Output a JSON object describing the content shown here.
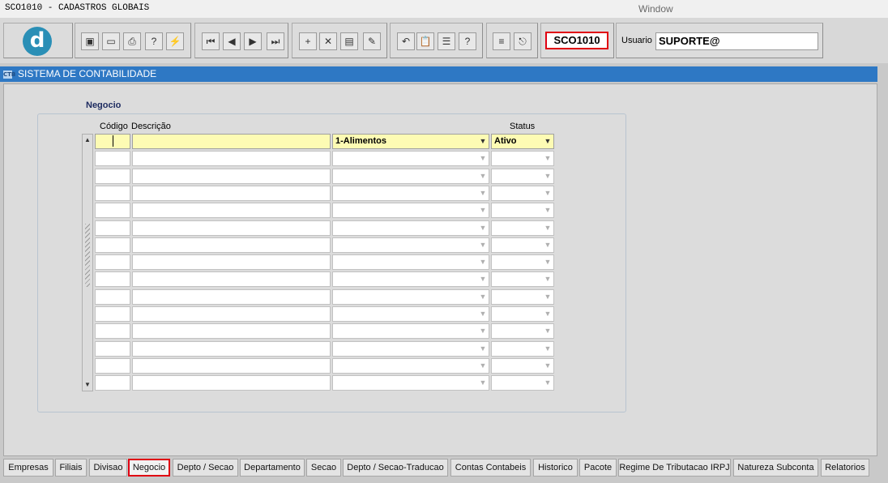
{
  "window": {
    "title": "SCO1010 - CADASTROS GLOBAIS",
    "menu": "Window"
  },
  "toolbar": {
    "logo_letter": "d",
    "form_code": "SCO1010",
    "user_label": "Usuario",
    "user_value": "SUPORTE@",
    "buttons": [
      {
        "name": "save-icon",
        "glyph": "▣"
      },
      {
        "name": "print-screen-icon",
        "glyph": "▭"
      },
      {
        "name": "printer-icon",
        "glyph": "⎙"
      },
      {
        "name": "enter-query-icon",
        "glyph": "?"
      },
      {
        "name": "execute-query-icon",
        "glyph": "⚡"
      },
      {
        "name": "first-record-icon",
        "glyph": "⏮"
      },
      {
        "name": "previous-record-icon",
        "glyph": "◀"
      },
      {
        "name": "next-record-icon",
        "glyph": "▶"
      },
      {
        "name": "last-record-icon",
        "glyph": "⏭"
      },
      {
        "name": "insert-record-icon",
        "glyph": "+"
      },
      {
        "name": "delete-record-icon",
        "glyph": "✕"
      },
      {
        "name": "duplicate-record-icon",
        "glyph": "▤"
      },
      {
        "name": "edit-record-icon",
        "glyph": "✎"
      },
      {
        "name": "undo-icon",
        "glyph": "↶"
      },
      {
        "name": "clipboard-icon",
        "glyph": "📋"
      },
      {
        "name": "list-values-icon",
        "glyph": "☰"
      },
      {
        "name": "help-icon",
        "glyph": "?"
      },
      {
        "name": "menu-icon",
        "glyph": "≡"
      },
      {
        "name": "exit-icon",
        "glyph": "⎋"
      }
    ]
  },
  "system_bar": {
    "icon": "ctb-icon",
    "icon_text": "CTB",
    "title": "SISTEMA DE CONTABILIDADE"
  },
  "block": {
    "title": "Negocio",
    "headers": {
      "codigo": "Código",
      "descricao": "Descrição",
      "status": "Status"
    },
    "rows": [
      {
        "codigo": "",
        "descricao": "",
        "grupo": "1-Alimentos",
        "status": "Ativo"
      },
      {
        "codigo": "",
        "descricao": "",
        "grupo": "",
        "status": ""
      },
      {
        "codigo": "",
        "descricao": "",
        "grupo": "",
        "status": ""
      },
      {
        "codigo": "",
        "descricao": "",
        "grupo": "",
        "status": ""
      },
      {
        "codigo": "",
        "descricao": "",
        "grupo": "",
        "status": ""
      },
      {
        "codigo": "",
        "descricao": "",
        "grupo": "",
        "status": ""
      },
      {
        "codigo": "",
        "descricao": "",
        "grupo": "",
        "status": ""
      },
      {
        "codigo": "",
        "descricao": "",
        "grupo": "",
        "status": ""
      },
      {
        "codigo": "",
        "descricao": "",
        "grupo": "",
        "status": ""
      },
      {
        "codigo": "",
        "descricao": "",
        "grupo": "",
        "status": ""
      },
      {
        "codigo": "",
        "descricao": "",
        "grupo": "",
        "status": ""
      },
      {
        "codigo": "",
        "descricao": "",
        "grupo": "",
        "status": ""
      },
      {
        "codigo": "",
        "descricao": "",
        "grupo": "",
        "status": ""
      },
      {
        "codigo": "",
        "descricao": "",
        "grupo": "",
        "status": ""
      },
      {
        "codigo": "",
        "descricao": "",
        "grupo": "",
        "status": ""
      }
    ]
  },
  "tabs": [
    {
      "label": "Empresas",
      "active": false
    },
    {
      "label": "Filiais",
      "active": false
    },
    {
      "label": "Divisao",
      "active": false
    },
    {
      "label": "Negocio",
      "active": true
    },
    {
      "label": "Depto / Secao",
      "active": false
    },
    {
      "label": "Departamento",
      "active": false
    },
    {
      "label": "Secao",
      "active": false
    },
    {
      "label": "Depto / Secao-Traducao",
      "active": false
    },
    {
      "label": "Contas Contabeis",
      "active": false
    },
    {
      "label": "Historico",
      "active": false
    },
    {
      "label": "Pacote",
      "active": false
    },
    {
      "label": "Regime De Tributacao IRPJ",
      "active": false
    },
    {
      "label": "Natureza Subconta",
      "active": false
    },
    {
      "label": "Relatorios",
      "active": false
    }
  ]
}
